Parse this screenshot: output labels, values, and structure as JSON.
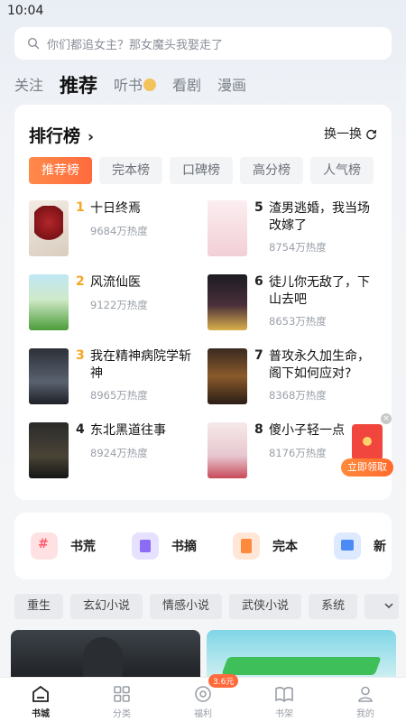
{
  "status": {
    "time": "10:04"
  },
  "search": {
    "placeholder": "你们都追女主？那女魔头我娶走了"
  },
  "tabs": [
    "关注",
    "推荐",
    "听书",
    "看剧",
    "漫画"
  ],
  "rank": {
    "title": "排行榜",
    "refresh": "换一换",
    "chips": [
      "推荐榜",
      "完本榜",
      "口碑榜",
      "高分榜",
      "人气榜"
    ],
    "books": [
      {
        "rank": "1",
        "name": "十日终焉",
        "heat": "9684万热度",
        "rank_color": "#f5a623"
      },
      {
        "rank": "2",
        "name": "风流仙医",
        "heat": "9122万热度",
        "rank_color": "#f5a623"
      },
      {
        "rank": "3",
        "name": "我在精神病院学斩神",
        "heat": "8965万热度",
        "rank_color": "#f5a623"
      },
      {
        "rank": "4",
        "name": "东北黑道往事",
        "heat": "8924万热度",
        "rank_color": "#222222"
      },
      {
        "rank": "5",
        "name": "渣男逃婚，我当场改嫁了",
        "heat": "8754万热度",
        "rank_color": "#222222"
      },
      {
        "rank": "6",
        "name": "徒儿你无敌了，下山去吧",
        "heat": "8653万热度",
        "rank_color": "#222222"
      },
      {
        "rank": "7",
        "name": "普攻永久加生命，阁下如何应对?",
        "heat": "8368万热度",
        "rank_color": "#222222"
      },
      {
        "rank": "8",
        "name": "傻小子轻一点",
        "heat": "8176万热度",
        "rank_color": "#222222"
      }
    ]
  },
  "categories": [
    "书荒",
    "书摘",
    "完本",
    "新"
  ],
  "tags": [
    "重生",
    "玄幻小说",
    "情感小说",
    "武侠小说",
    "系统"
  ],
  "float_gift": {
    "button": "立即领取",
    "close": "×"
  },
  "nav": {
    "items": [
      "书城",
      "分类",
      "福利",
      "书架",
      "我的"
    ],
    "badge": "3.6元"
  }
}
